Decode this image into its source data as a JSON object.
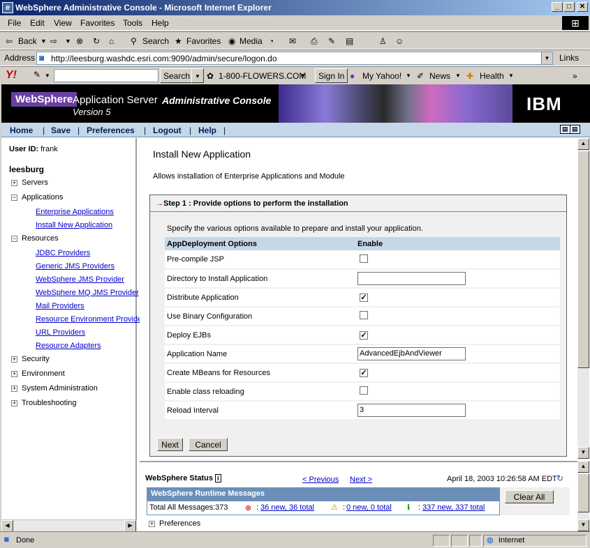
{
  "window": {
    "title": "WebSphere Administrative Console - Microsoft Internet Explorer",
    "buttons": [
      "_",
      "□",
      "✕"
    ]
  },
  "menu": [
    "File",
    "Edit",
    "View",
    "Favorites",
    "Tools",
    "Help"
  ],
  "toolbar": {
    "back": "Back",
    "search": "Search",
    "favorites": "Favorites",
    "media": "Media"
  },
  "address": {
    "label": "Address",
    "url": "http://leesburg.washdc.esri.com:9090/admin/secure/logon.do",
    "links": "Links"
  },
  "yahoo": {
    "search_btn": "Search",
    "flowers": "1-800-FLOWERS.COM",
    "signin": "Sign In",
    "myyahoo": "My Yahoo!",
    "news": "News",
    "health": "Health"
  },
  "banner": {
    "brand": "WebSphere",
    "product": "Application Server",
    "version": "Version 5",
    "console": "Administrative Console",
    "ibm": "IBM"
  },
  "nav": [
    "Home",
    "Save",
    "Preferences",
    "Logout",
    "Help"
  ],
  "sidebar": {
    "user_label": "User ID:",
    "user": "frank",
    "node": "leesburg",
    "servers": "Servers",
    "applications": "Applications",
    "app_items": [
      "Enterprise Applications",
      "Install New Application"
    ],
    "resources": "Resources",
    "res_items": [
      "JDBC Providers",
      "Generic JMS Providers",
      "WebSphere JMS Provider",
      "WebSphere MQ JMS Provider",
      "Mail Providers",
      "Resource Environment Providers",
      "URL Providers",
      "Resource Adapters"
    ],
    "bottom": [
      "Security",
      "Environment",
      "System Administration",
      "Troubleshooting"
    ]
  },
  "main": {
    "title": "Install New Application",
    "desc": "Allows installation of Enterprise Applications and Module",
    "step": "Step 1 :  Provide options to perform the installation",
    "specify": "Specify the various options available to prepare and install your application.",
    "col_options": "AppDeployment Options",
    "col_enable": "Enable",
    "rows": [
      {
        "label": "Pre-compile JSP",
        "type": "checkbox",
        "checked": false
      },
      {
        "label": "Directory to Install Application",
        "type": "text",
        "value": ""
      },
      {
        "label": "Distribute Application",
        "type": "checkbox",
        "checked": true
      },
      {
        "label": "Use Binary Configuration",
        "type": "checkbox",
        "checked": false
      },
      {
        "label": "Deploy EJBs",
        "type": "checkbox",
        "checked": true
      },
      {
        "label": "Application Name",
        "type": "text",
        "value": "AdvancedEjbAndViewer"
      },
      {
        "label": "Create MBeans for Resources",
        "type": "checkbox",
        "checked": true
      },
      {
        "label": "Enable class reloading",
        "type": "checkbox",
        "checked": false
      },
      {
        "label": "Reload Interval",
        "type": "text",
        "value": "3"
      }
    ],
    "next": "Next",
    "cancel": "Cancel"
  },
  "wsstatus": {
    "title": "WebSphere Status",
    "prev": "< Previous",
    "next": "Next >",
    "date": "April 18, 2003 10:26:58 AM EDT",
    "runtime": "WebSphere Runtime Messages",
    "clear": "Clear All",
    "total": "Total All Messages:373",
    "errors": "36 new, 36 total",
    "warnings": "0 new, 0 total",
    "info": "337 new, 337 total",
    "prefs": "Preferences"
  },
  "statusbar": {
    "text": "Done",
    "zone": "Internet"
  }
}
